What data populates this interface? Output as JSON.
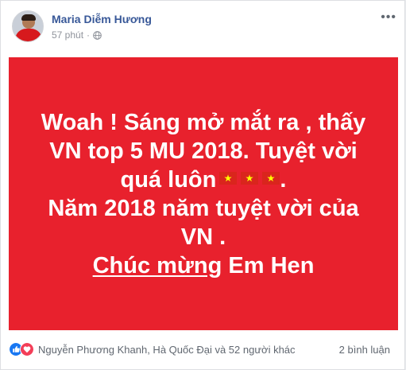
{
  "post": {
    "author": "Maria Diễm Hương",
    "time": "57 phút",
    "separator": "·",
    "icons": {
      "avatar": "avatar-photo",
      "privacy": "globe-icon",
      "more": "more-icon"
    },
    "background_color": "#e8212d",
    "text_lines": {
      "line1": "Woah ! Sáng mở mắt ra , thấy",
      "line2": "VN top 5 MU 2018. Tuyệt vời",
      "line3": "quá luôn",
      "line4": "Năm 2018 năm tuyệt vời của",
      "line5": "VN .",
      "line6_underlined": "Chúc mừng",
      "line6_rest": " Em Hen"
    },
    "line3_suffix": ".",
    "flag_count": 3
  },
  "footer": {
    "reaction_icons": [
      "like-icon",
      "love-icon"
    ],
    "reactions_text": "Nguyễn Phương Khanh, Hà Quốc Đại và 52 người khác",
    "comments": "2 bình luận"
  },
  "colors": {
    "link": "#385898",
    "meta": "#90949c",
    "like": "#1877f2",
    "love": "#f33e58",
    "flag_red": "#da251d",
    "flag_star": "#ffff00"
  }
}
